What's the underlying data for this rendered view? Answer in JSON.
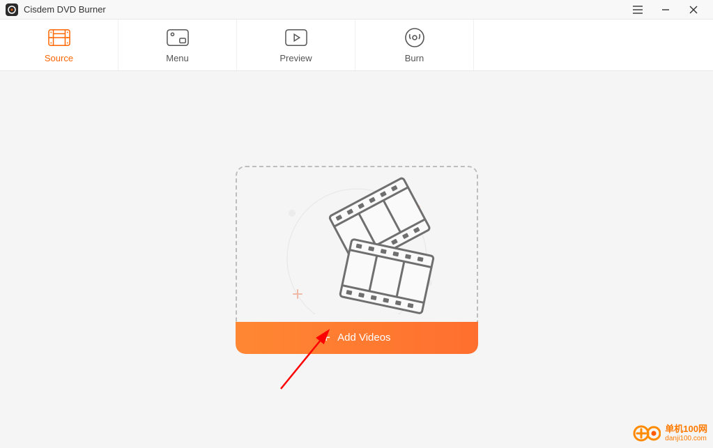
{
  "titlebar": {
    "app_name": "Cisdem DVD Burner"
  },
  "tabs": {
    "source": "Source",
    "menu": "Menu",
    "preview": "Preview",
    "burn": "Burn",
    "active": "source"
  },
  "dropzone": {
    "add_videos_label": "Add Videos"
  },
  "watermark": {
    "line1": "单机100网",
    "line2": "danji100.com"
  }
}
